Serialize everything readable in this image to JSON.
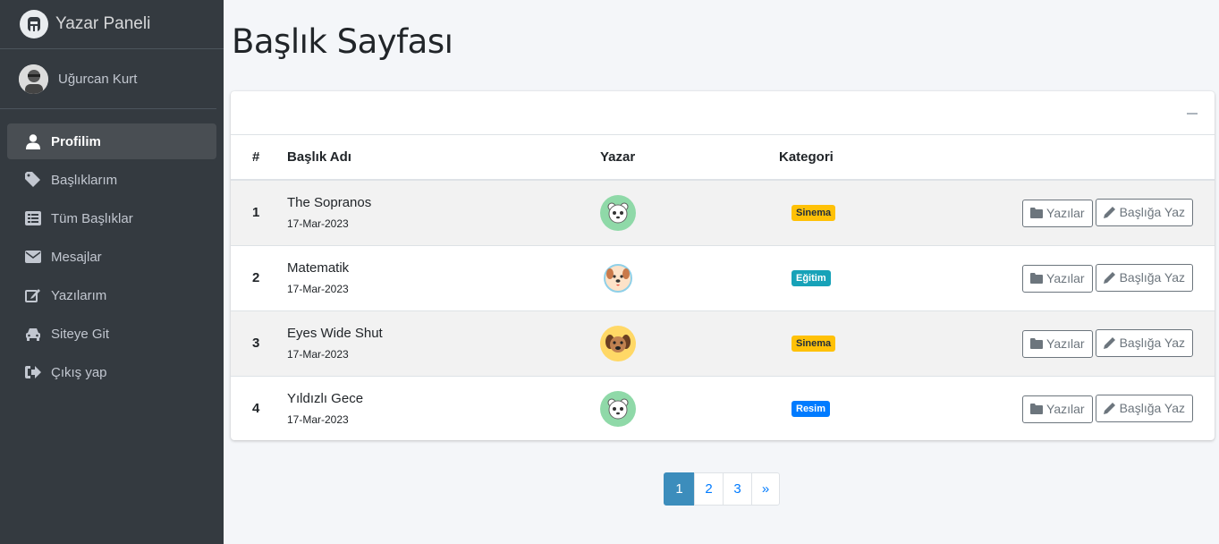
{
  "brand": {
    "name": "Yazar Paneli",
    "icon": "brand-logo-icon"
  },
  "user": {
    "name": "Uğurcan Kurt",
    "avatar": "user-avatar"
  },
  "sidebar": {
    "items": [
      {
        "label": "Profilim",
        "icon": "user-icon",
        "active": true
      },
      {
        "label": "Başlıklarım",
        "icon": "tag-icon"
      },
      {
        "label": "Tüm Başlıklar",
        "icon": "list-icon"
      },
      {
        "label": "Mesajlar",
        "icon": "envelope-icon"
      },
      {
        "label": "Yazılarım",
        "icon": "edit-icon"
      },
      {
        "label": "Siteye Git",
        "icon": "car-icon"
      },
      {
        "label": "Çıkış yap",
        "icon": "sign-out-icon"
      }
    ]
  },
  "page": {
    "title": "Başlık Sayfası"
  },
  "table": {
    "headers": [
      "#",
      "Başlık Adı",
      "Yazar",
      "Kategori"
    ],
    "rows": [
      {
        "num": "1",
        "title": "The Sopranos",
        "date": "17-Mar-2023",
        "avatar": "panda-avatar",
        "category": "Sinema",
        "category_color": "#ffc107"
      },
      {
        "num": "2",
        "title": "Matematik",
        "date": "17-Mar-2023",
        "avatar": "dog-avatar",
        "category": "Eğitim",
        "category_color": "#17a2b8"
      },
      {
        "num": "3",
        "title": "Eyes Wide Shut",
        "date": "17-Mar-2023",
        "avatar": "puppy-avatar",
        "category": "Sinema",
        "category_color": "#ffc107"
      },
      {
        "num": "4",
        "title": "Yıldızlı Gece",
        "date": "17-Mar-2023",
        "avatar": "panda-avatar",
        "category": "Resim",
        "category_color": "#007bff"
      }
    ],
    "actions": {
      "posts_label": "Yazılar",
      "write_label": "Başlığa Yaz"
    }
  },
  "pagination": {
    "pages": [
      "1",
      "2",
      "3"
    ],
    "next": "»",
    "active": "1"
  }
}
